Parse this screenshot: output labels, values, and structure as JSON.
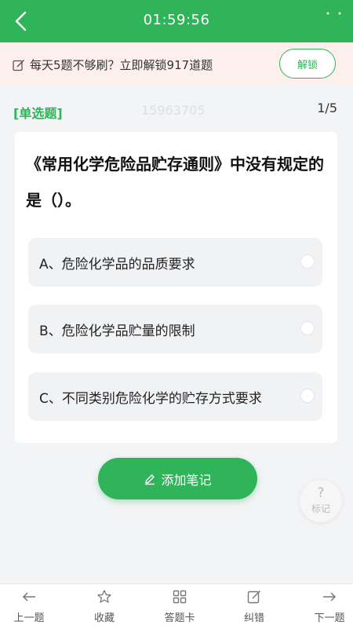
{
  "header": {
    "timer": "01:59:56"
  },
  "promo": {
    "text": "每天5题不够刷？立即解锁917道题",
    "unlock_label": "解锁"
  },
  "question": {
    "type": "[单选题]",
    "id": "15963705",
    "progress": "1/5",
    "stem": "《常用化学危险品贮存通则》中没有规定的是（）。",
    "options": [
      "A、危险化学品的品质要求",
      "B、危险化学品贮量的限制",
      "C、不同类别危险化学的贮存方式要求"
    ]
  },
  "add_note_label": "添加笔记",
  "mark": {
    "symbol": "?",
    "label": "标记"
  },
  "bottom_nav": {
    "prev": "上一题",
    "favorite": "收藏",
    "answer_sheet": "答题卡",
    "report_error": "纠错",
    "next": "下一题"
  },
  "colors": {
    "brand": "#2fb45a",
    "promo_bg": "#fdf0ec"
  }
}
